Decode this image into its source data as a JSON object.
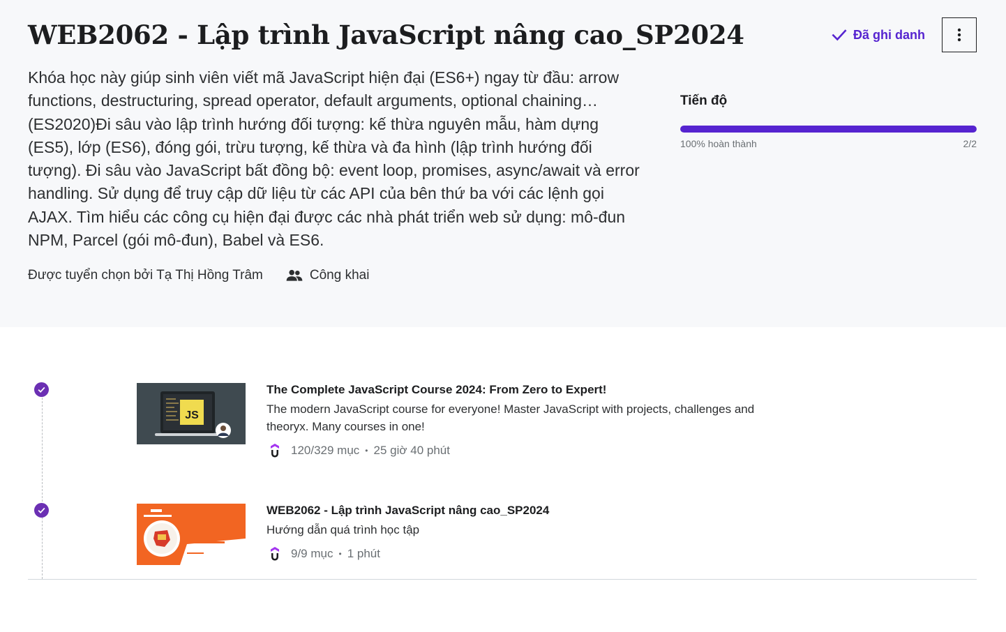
{
  "course": {
    "title": "WEB2062 - Lập trình JavaScript nâng cao_SP2024",
    "enrolled_label": "Đã ghi danh",
    "description": "Khóa học này giúp sinh viên viết mã JavaScript hiện đại (ES6+) ngay từ đầu: arrow functions, destructuring, spread operator, default arguments, optional chaining…(ES2020)Đi sâu vào lập trình hướng đối tượng: kế thừa nguyên mẫu, hàm dựng (ES5), lớp (ES6), đóng gói, trừu tượng, kế thừa và đa hình (lập trình hướng đối tượng). Đi sâu vào JavaScript bất đồng bộ: event loop, promises, async/await và error handling. Sử dụng để truy cập dữ liệu từ các API của bên thứ ba với các lệnh gọi AJAX. Tìm hiểu các công cụ hiện đại được các nhà phát triển web sử dụng: mô-đun NPM, Parcel (gói mô-đun), Babel và ES6.",
    "curated_by": "Được tuyển chọn bởi Tạ Thị Hồng Trâm",
    "visibility": "Công khai"
  },
  "progress": {
    "label": "Tiến độ",
    "percent": 100,
    "completed_text": "100% hoàn thành",
    "count_text": "2/2"
  },
  "items": [
    {
      "title": "The Complete JavaScript Course 2024: From Zero to Expert!",
      "subtitle": "The modern JavaScript course for everyone! Master JavaScript with projects, challenges and theoryx. Many courses in one!",
      "items_text": "120/329 mục",
      "duration": "25 giờ 40 phút",
      "thumb_badge": "JS"
    },
    {
      "title": "WEB2062 - Lập trình JavaScript nâng cao_SP2024",
      "subtitle": "Hướng dẫn quá trình học tập",
      "items_text": "9/9 mục",
      "duration": "1 phút"
    }
  ],
  "colors": {
    "accent": "#5624d0",
    "check_badge": "#6b2fb3",
    "hero_bg": "#f7f8fa"
  },
  "icons": [
    "check-icon",
    "more-vertical-icon",
    "people-icon",
    "udemy-u-icon",
    "check-circle-icon"
  ]
}
